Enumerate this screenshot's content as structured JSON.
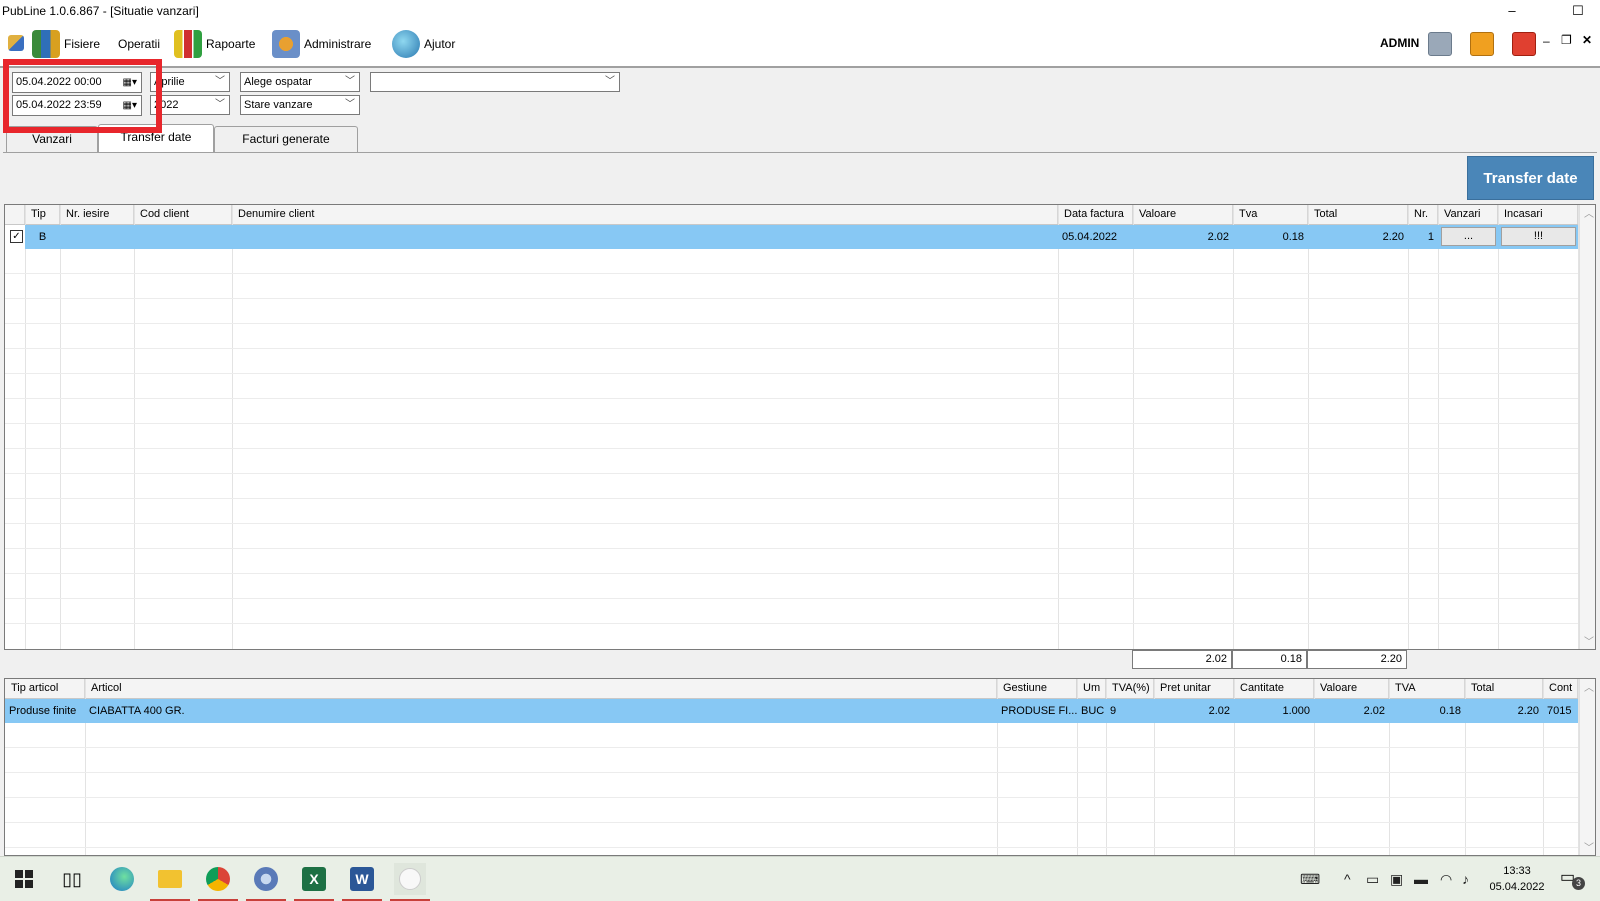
{
  "window": {
    "title": "PubLine 1.0.6.867 - [Situatie vanzari]",
    "minimize_glyph": "–",
    "maximize_glyph": "☐",
    "inner_min_glyph": "‒",
    "inner_restore_glyph": "❐",
    "inner_close_glyph": "✕"
  },
  "menu": {
    "items": [
      {
        "label": "Fisiere",
        "icon": "books-icon"
      },
      {
        "label": "Operatii",
        "icon": ""
      },
      {
        "label": "Rapoarte",
        "icon": "bar-chart-icon"
      },
      {
        "label": "Administrare",
        "icon": "tools-icon"
      },
      {
        "label": "Ajutor",
        "icon": "help-globe-icon"
      }
    ],
    "user": "ADMIN"
  },
  "filters": {
    "date_from": "05.04.2022   00:00",
    "date_to": "05.04.2022   23:59",
    "month": "Aprilie",
    "year": "2022",
    "waiter_placeholder": "Alege ospatar",
    "sale_state": "Stare vanzare",
    "extra_combo": ""
  },
  "tabs": [
    {
      "label": "Vanzari"
    },
    {
      "label": "Transfer date"
    },
    {
      "label": "Facturi generate"
    }
  ],
  "transfer_button": "Transfer date",
  "top_grid": {
    "columns": [
      "Tip",
      "Nr. iesire",
      "Cod client",
      "Denumire client",
      "Data factura",
      "Valoare",
      "Tva",
      "Total",
      "Nr.",
      "Vanzari",
      "Incasari"
    ],
    "rows": [
      {
        "checked": true,
        "tip": "B",
        "nr_iesire": "",
        "cod_client": "",
        "denumire": "",
        "data": "05.04.2022",
        "valoare": "2.02",
        "tva": "0.18",
        "total": "2.20",
        "nr": "1",
        "vanzari": "...",
        "incasari": "!!!"
      }
    ],
    "totals": {
      "valoare": "2.02",
      "tva": "0.18",
      "total": "2.20"
    }
  },
  "bottom_grid": {
    "columns": [
      "Tip articol",
      "Articol",
      "Gestiune",
      "Um",
      "TVA(%)",
      "Pret unitar",
      "Cantitate",
      "Valoare",
      "TVA",
      "Total",
      "Cont"
    ],
    "rows": [
      {
        "tip": "Produse finite",
        "articol": "CIABATTA 400 GR.",
        "gestiune": "PRODUSE FI...",
        "um": "BUC",
        "tva_pct": "9",
        "pret": "2.02",
        "cantitate": "1.000",
        "valoare": "2.02",
        "tva": "0.18",
        "total": "2.20",
        "cont": "7015"
      }
    ]
  },
  "taskbar": {
    "time": "13:33",
    "date": "05.04.2022",
    "notifications": "3"
  },
  "colors": {
    "selection": "#87c8f4",
    "transfer_button": "#4a86b8",
    "highlight_box": "#e8262c"
  }
}
